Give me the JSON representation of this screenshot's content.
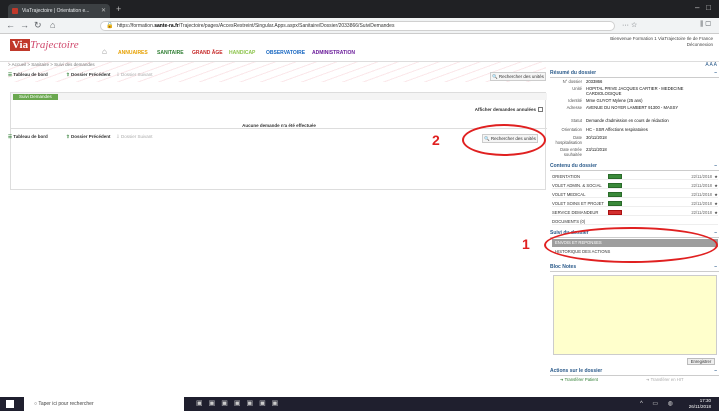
{
  "browser": {
    "tab_title": "ViaTrajectoire | Orientation e...",
    "url_prefix": "https://formation.",
    "url_host": "sante-ra.fr",
    "url_path": "/Trajectoire/pages/AccesRestreint/Singular.Apps.aspx/Sanitaire/Dossier/2033866/SuiviDemandes"
  },
  "app": {
    "logo_via": "Via",
    "logo_traj": "Trajectoire",
    "menu": [
      {
        "label": "ANNUAIRES",
        "color": "#e6a000"
      },
      {
        "label": "SANITAIRE",
        "color": "#2e7d32"
      },
      {
        "label": "GRAND ÂGE",
        "color": "#c62828"
      },
      {
        "label": "HANDICAP",
        "color": "#8bc34a"
      },
      {
        "label": "OBSERVATOIRE",
        "color": "#1565c0"
      },
      {
        "label": "ADMINISTRATION",
        "color": "#6a1b9a"
      }
    ],
    "welcome_line1": "Bienvenue Formation 1 ViaTrajectoire Ile de France",
    "welcome_line2": "Déconnexion"
  },
  "main": {
    "breadcrumb": "> Accueil > Sanitaire > Suivi des demandes",
    "btn_dashboard": "Tableau de bord",
    "btn_prev": "Dossier Précédent",
    "btn_next": "Dossier Suivant",
    "btn_search": "Rechercher des unités",
    "panel_tab": "Suivi Demandes",
    "archived_label": "Afficher demandes annulées",
    "empty_message": "Aucune demande n'a été effectuée"
  },
  "sidebar": {
    "resume_title": "Résumé du dossier",
    "fields": [
      {
        "k": "N° dossier",
        "v": "2033866"
      },
      {
        "k": "Unité",
        "v": "HOPITAL PRIVE JACQUES CARTIER - MEDECINE CARDIOLOGIQUE"
      },
      {
        "k": "Identité",
        "v": "Mme GUYOT Mylene (25 ans)"
      },
      {
        "k": "Adresse",
        "v": "AVENUE DU NOYER LAMBERT 91300 - MASSY"
      },
      {
        "k": "Statut",
        "v": "Demande d'admission en cours de rédaction"
      },
      {
        "k": "Orientation",
        "v": "HC - SSR Affections respiratoires"
      },
      {
        "k": "Date hospitalisation",
        "v": "30/11/2018"
      },
      {
        "k": "Date entrée souhaitée",
        "v": "23/11/2018"
      }
    ],
    "contenu_title": "Contenu du dossier",
    "contenu": [
      {
        "name": "ORIENTATION",
        "date": "22/11/2018",
        "status": "ok"
      },
      {
        "name": "VOLET ADMIN. & SOCIAL",
        "date": "22/11/2018",
        "status": "ok"
      },
      {
        "name": "VOLET MEDICAL",
        "date": "22/11/2018",
        "status": "ok"
      },
      {
        "name": "VOLET SOINS ET PROJET",
        "date": "22/11/2018",
        "status": "ok"
      },
      {
        "name": "SERVICE DEMANDEUR",
        "date": "22/11/2018",
        "status": "err"
      },
      {
        "name": "DOCUMENTS (0)",
        "date": "",
        "status": ""
      }
    ],
    "suivi_title": "Suivi du dossier",
    "suivi_items": [
      "ENVOIS ET REPONSES",
      "HISTORIQUE DES ACTIONS"
    ],
    "notes_title": "Bloc Notes",
    "save_label": "Enregistrer",
    "actions_title": "Actions sur le dossier",
    "action_transfer": "Transférer Patient",
    "action_transfer_disabled": "Transférer en HIT"
  },
  "annotations": {
    "label1": "1",
    "label2": "2"
  },
  "taskbar": {
    "search_placeholder": "Taper ici pour rechercher",
    "time": "17:30",
    "date": "26/11/2018"
  }
}
